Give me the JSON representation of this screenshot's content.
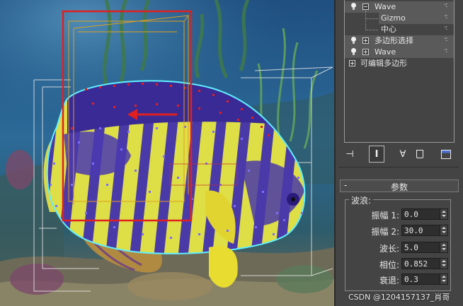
{
  "modifier_stack": {
    "items": [
      {
        "label": "Wave",
        "has_light": true,
        "expander": "minus",
        "selected": true
      },
      {
        "label": "Gizmo",
        "sub": true
      },
      {
        "label": "中心",
        "sub": true
      },
      {
        "label": "多边形选择",
        "has_light": true,
        "expander": "plus"
      },
      {
        "label": "Wave",
        "has_light": true,
        "expander": "plus"
      },
      {
        "label": "可编辑多边形",
        "has_light": false,
        "expander": "plus"
      }
    ]
  },
  "toolbar": {
    "buttons": [
      {
        "name": "pin-stack-icon",
        "glyph": "⊣"
      },
      {
        "name": "show-end-result-icon",
        "glyph": "Ⅰ",
        "active": true
      },
      {
        "name": "make-unique-icon",
        "glyph": "∀"
      },
      {
        "name": "remove-modifier-icon",
        "glyph": "🗑"
      },
      {
        "name": "configure-modifier-sets-icon",
        "glyph": "▤"
      }
    ]
  },
  "rollout": {
    "collapse_glyph": "-",
    "title": "参数",
    "group_label": "波浪:",
    "params": [
      {
        "label": "振幅 1:",
        "value": "0.0"
      },
      {
        "label": "振幅 2:",
        "value": "30.0"
      },
      {
        "label": "波长:",
        "value": "5.0"
      },
      {
        "label": "相位:",
        "value": "0.852"
      },
      {
        "label": "衰退:",
        "value": "0.3"
      }
    ]
  },
  "watermark": "CSDN @1204157137_肖哥",
  "colors": {
    "accent_red": "#e02020",
    "gizmo_orange": "#e0a020",
    "selection_cyan": "#5ff0ff",
    "vertex_blue": "#6a5cff"
  }
}
